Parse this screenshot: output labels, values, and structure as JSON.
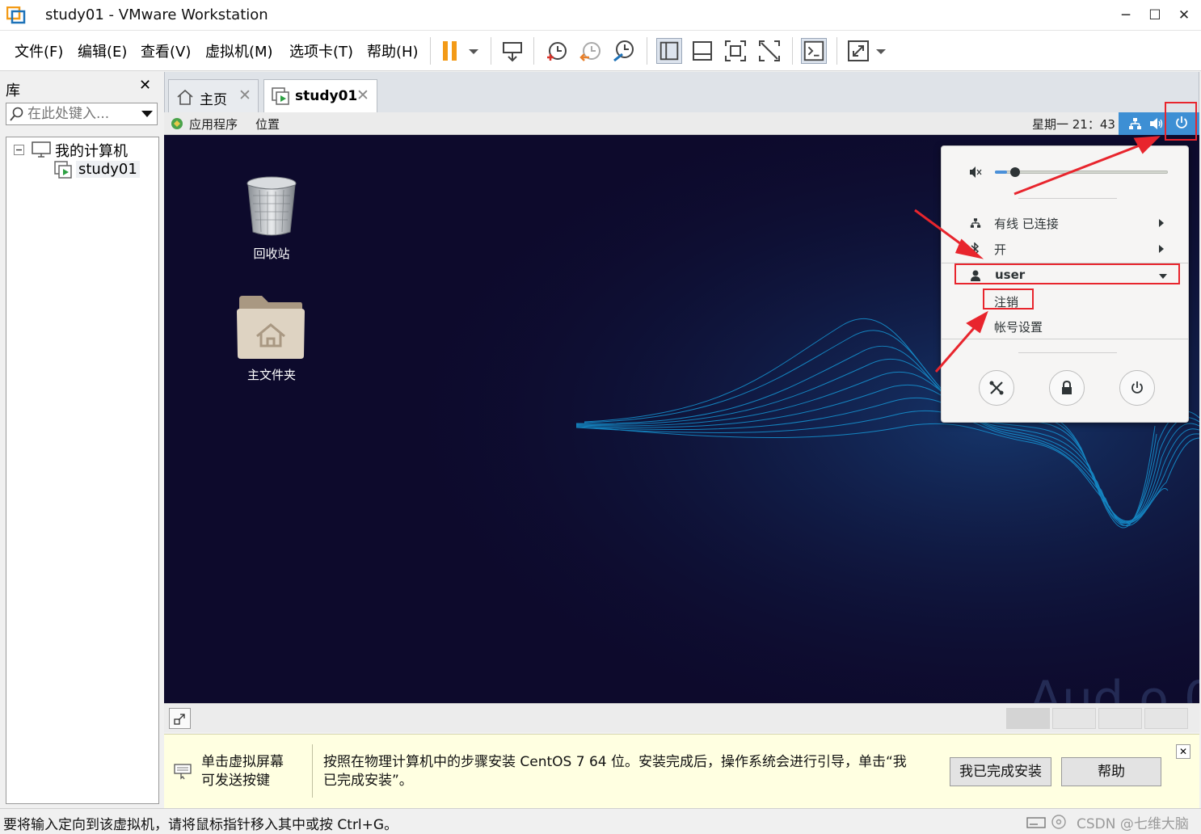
{
  "window": {
    "title": "study01 - VMware Workstation",
    "minimize": "─",
    "maximize": "☐",
    "close": "✕"
  },
  "menu": {
    "file": "文件(F)",
    "edit": "编辑(E)",
    "view": "查看(V)",
    "vm": "虚拟机(M)",
    "tabs": "选项卡(T)",
    "help": "帮助(H)"
  },
  "library": {
    "title": "库",
    "close": "✕",
    "search_placeholder": "在此处键入...",
    "tree": {
      "root": "我的计算机",
      "child": "study01"
    }
  },
  "tabs": [
    {
      "label": "主页",
      "close": "✕"
    },
    {
      "label": "study01",
      "close": "✕"
    }
  ],
  "guest_panel": {
    "applications": "应用程序",
    "places": "位置",
    "clock": "星期一 21：43"
  },
  "desktop": {
    "trash": "回收站",
    "home": "主文件夹"
  },
  "system_menu": {
    "wired": "有线 已连接",
    "bluetooth": "开",
    "user": "user",
    "logout": "注销",
    "account_settings": "帐号设置",
    "volume_level": 0.07
  },
  "hint": {
    "left_line1": "单击虚拟屏幕",
    "left_line2": "可发送按键",
    "main_line1": "按照在物理计算机中的步骤安装 CentOS 7 64 位。安装完成后，操作系统会进行引导，单击“我",
    "main_line2": "已完成安装”。",
    "done_button": "我已完成安装",
    "help_button": "帮助",
    "close": "✕"
  },
  "status": {
    "text": "要将输入定向到该虚拟机，请将鼠标指针移入其中或按 Ctrl+G。",
    "watermark": "CSDN @七维大脑"
  },
  "colors": {
    "accent": "#3d8fd4",
    "annotation_red": "#e8252d",
    "pause_orange": "#f39a16",
    "vm_background": "#0d0a2c"
  }
}
